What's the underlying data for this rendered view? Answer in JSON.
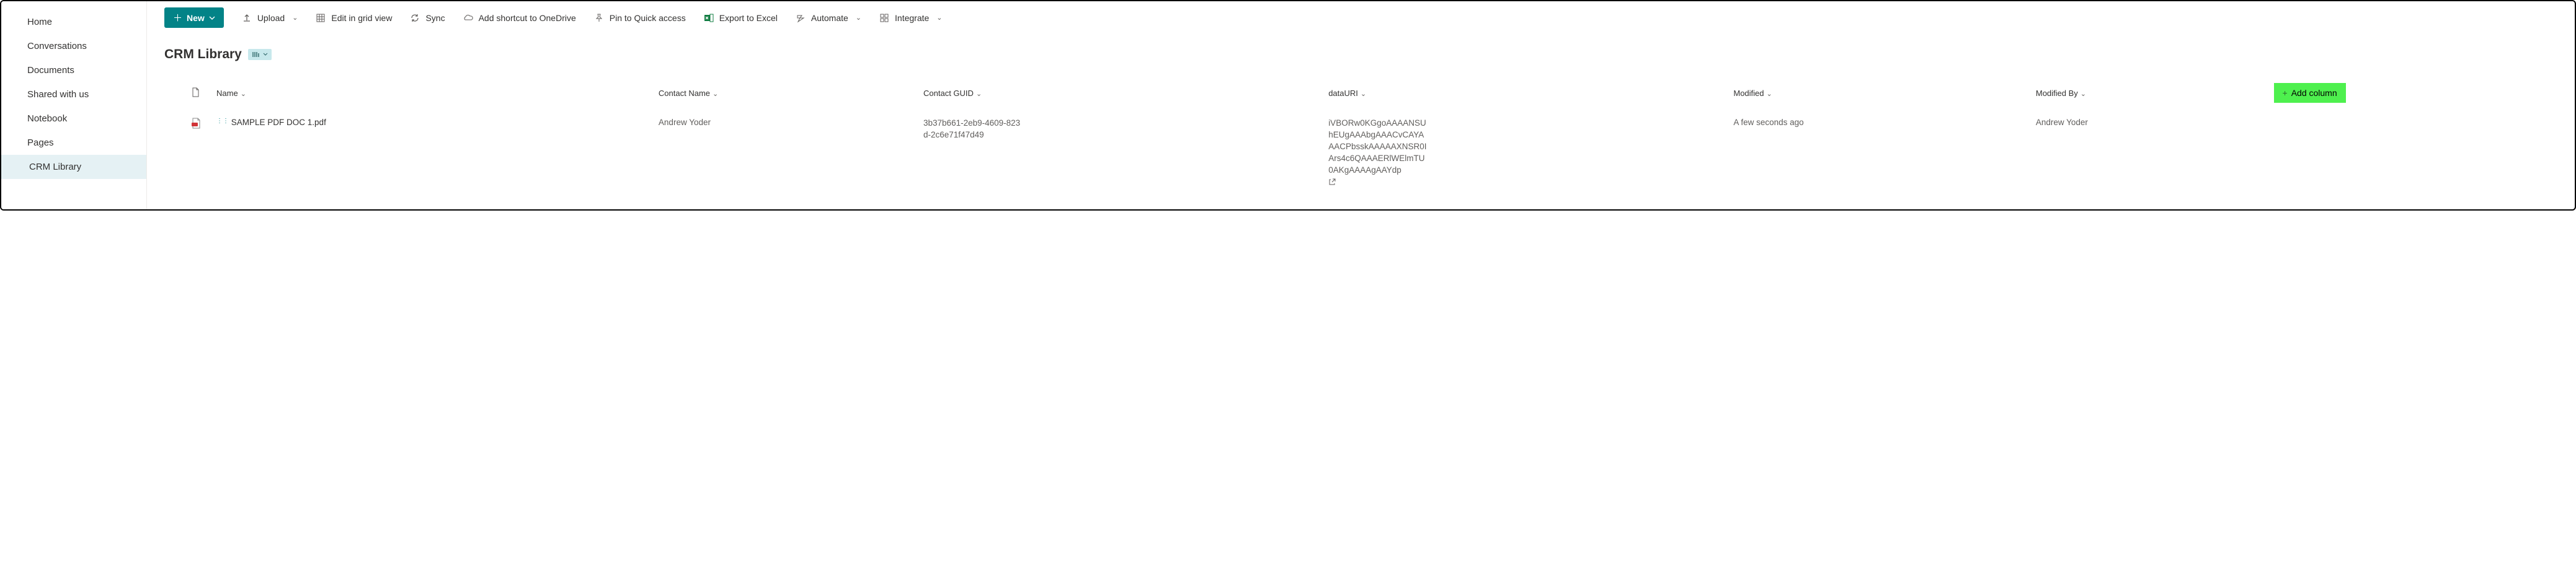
{
  "sidebar": {
    "items": [
      {
        "label": "Home"
      },
      {
        "label": "Conversations"
      },
      {
        "label": "Documents"
      },
      {
        "label": "Shared with us"
      },
      {
        "label": "Notebook"
      },
      {
        "label": "Pages"
      },
      {
        "label": "CRM Library"
      }
    ]
  },
  "toolbar": {
    "new_label": "New",
    "upload": "Upload",
    "edit_grid": "Edit in grid view",
    "sync": "Sync",
    "add_shortcut": "Add shortcut to OneDrive",
    "pin": "Pin to Quick access",
    "export": "Export to Excel",
    "automate": "Automate",
    "integrate": "Integrate"
  },
  "library": {
    "title": "CRM Library"
  },
  "columns": {
    "name": "Name",
    "contact_name": "Contact Name",
    "contact_guid": "Contact GUID",
    "data_uri": "dataURI",
    "modified": "Modified",
    "modified_by": "Modified By",
    "add_column": "Add column"
  },
  "rows": [
    {
      "name": "SAMPLE PDF DOC 1.pdf",
      "contact_name": "Andrew Yoder",
      "contact_guid": "3b37b661-2eb9-4609-823d-2c6e71f47d49",
      "data_uri": "iVBORw0KGgoAAAANSUhEUgAAAbgAAACvCAYAAACPbsskAAAAAXNSR0IArs4c6QAAAERlWElmTU0AKgAAAAgAAYdp",
      "modified": "A few seconds ago",
      "modified_by": "Andrew Yoder"
    }
  ]
}
